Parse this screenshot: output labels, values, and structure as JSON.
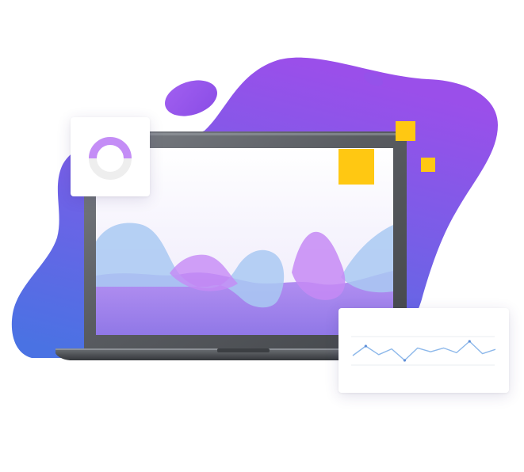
{
  "colors": {
    "blob_top": "#9a4fea",
    "blob_bottom": "#4a72e3",
    "accent_yellow": "#ffc812",
    "donut_ring": "#c48df6",
    "donut_track": "#eeeeee",
    "laptop_body": "#5b5e63",
    "wave_blue": "#9fc3ef",
    "wave_purple": "#c58af5",
    "line_stroke": "#8db8ea"
  },
  "donut": {
    "fraction": 0.5
  },
  "sparkline": {
    "values": [
      1,
      3,
      1.2,
      2.4,
      0,
      2.6,
      1.8,
      2.6,
      1.6,
      4,
      1.4,
      2.3
    ]
  }
}
